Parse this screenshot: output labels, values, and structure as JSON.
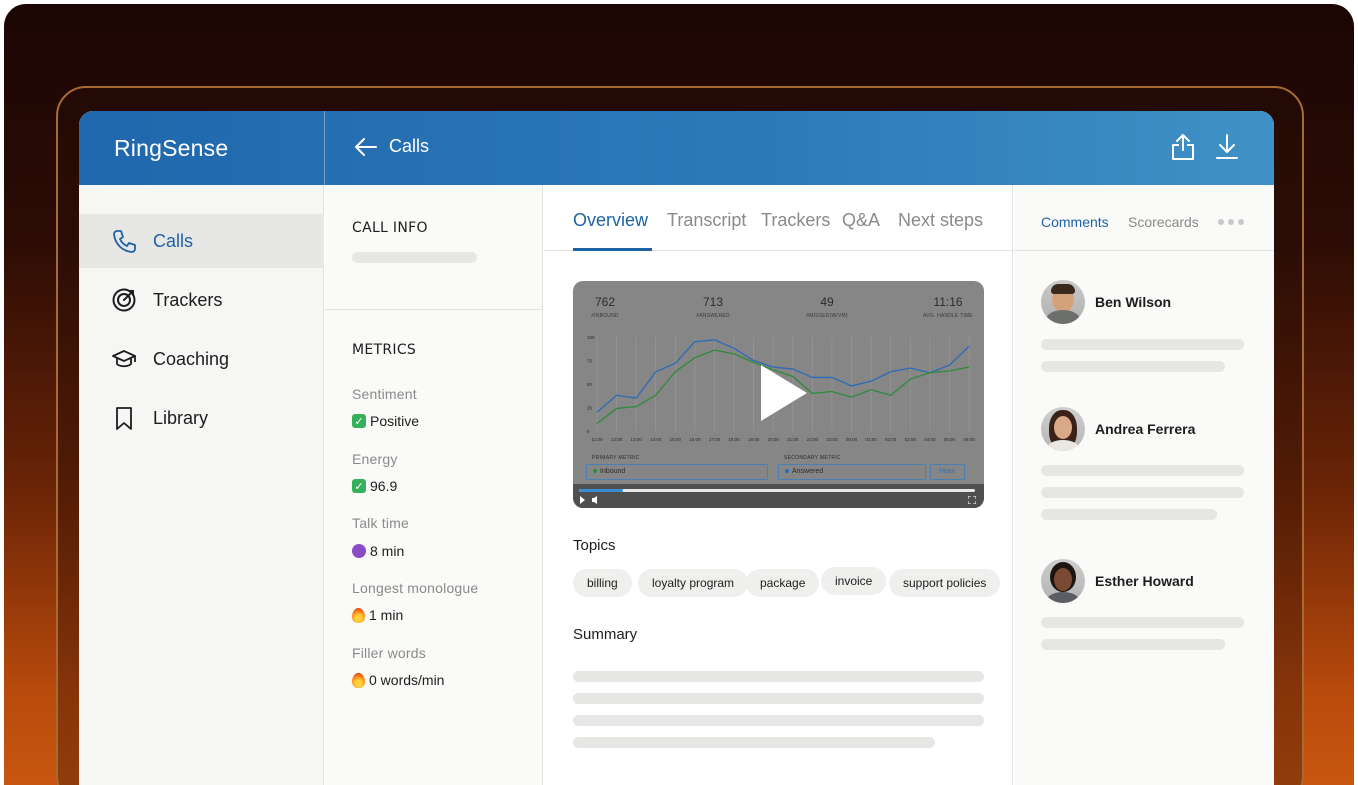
{
  "app": {
    "brand": "RingSense"
  },
  "header": {
    "back_label": "Calls"
  },
  "sidebar": {
    "items": [
      {
        "label": "Calls"
      },
      {
        "label": "Trackers"
      },
      {
        "label": "Coaching"
      },
      {
        "label": "Library"
      }
    ]
  },
  "call_info": {
    "title": "CALL INFO"
  },
  "metrics": {
    "title": "METRICS",
    "items": [
      {
        "label": "Sentiment",
        "value": "Positive",
        "icon": "check-emoji"
      },
      {
        "label": "Energy",
        "value": "96.9",
        "icon": "check-emoji"
      },
      {
        "label": "Talk time",
        "value": "8 min",
        "icon": "devil-emoji"
      },
      {
        "label": "Longest monologue",
        "value": "1 min",
        "icon": "fire-emoji"
      },
      {
        "label": "Filler words",
        "value": "0 words/min",
        "icon": "fire-emoji"
      }
    ]
  },
  "tabs": [
    "Overview",
    "Transcript",
    "Trackers",
    "Q&A",
    "Next steps"
  ],
  "video": {
    "stats": [
      {
        "value": "762",
        "label": "#INBOUND"
      },
      {
        "value": "713",
        "label": "#ANSWERED"
      },
      {
        "value": "49",
        "label": "#MISSED(W/VM)"
      },
      {
        "value": "11:16",
        "label": "AVG. HANDLE TIME"
      }
    ],
    "primary_metric_label": "PRIMARY METRIC",
    "primary_metric_value": "Inbound",
    "secondary_metric_label": "SECONDARY METRIC",
    "secondary_metric_value": "Answered",
    "interval_button": "Hour",
    "progress": 0.11
  },
  "chart_data": {
    "type": "line",
    "ylim": [
      0,
      100
    ],
    "yticks": [
      "100",
      "75",
      "50",
      "25",
      "0"
    ],
    "categories": [
      "11:00",
      "12:00",
      "13:00",
      "14:00",
      "15:00",
      "16:00",
      "17:00",
      "18:00",
      "19:00",
      "20:00",
      "21:00",
      "22:00",
      "23:00",
      "00:00",
      "01:00",
      "02:00",
      "03:00",
      "04:00",
      "05:00",
      "06:00"
    ],
    "series": [
      {
        "color": "#2a6bb8",
        "values": [
          20,
          38,
          35,
          63,
          72,
          95,
          97,
          88,
          75,
          68,
          66,
          57,
          57,
          48,
          53,
          63,
          67,
          62,
          70,
          90
        ]
      },
      {
        "color": "#2e8b3c",
        "values": [
          8,
          24,
          26,
          38,
          63,
          78,
          86,
          82,
          73,
          65,
          58,
          40,
          42,
          36,
          44,
          38,
          55,
          62,
          64,
          68
        ]
      }
    ]
  },
  "topics": {
    "title": "Topics",
    "items": [
      "billing",
      "loyalty program",
      "package",
      "invoice",
      "support policies"
    ]
  },
  "summary": {
    "title": "Summary"
  },
  "right_tabs": [
    "Comments",
    "Scorecards"
  ],
  "comments": [
    {
      "name": "Ben Wilson"
    },
    {
      "name": "Andrea Ferrera"
    },
    {
      "name": "Esther Howard"
    }
  ],
  "colors": {
    "accent": "#1e62a6",
    "header": "#2067ad"
  }
}
